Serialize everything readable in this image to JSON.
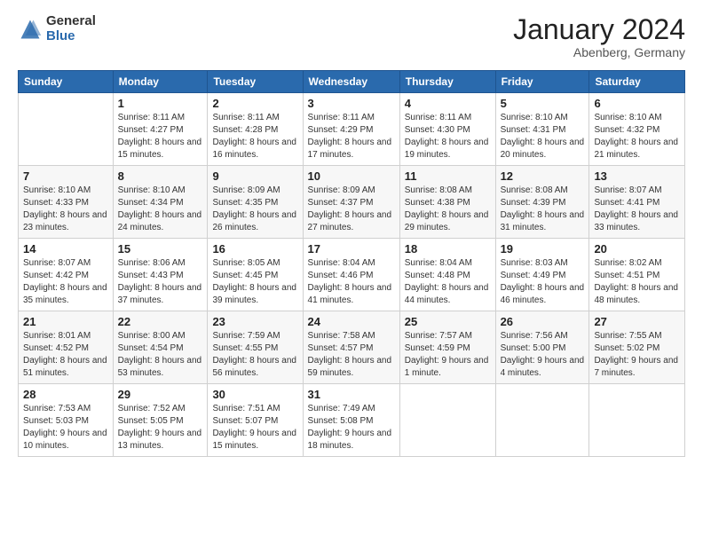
{
  "header": {
    "logo_general": "General",
    "logo_blue": "Blue",
    "month_title": "January 2024",
    "location": "Abenberg, Germany"
  },
  "days_of_week": [
    "Sunday",
    "Monday",
    "Tuesday",
    "Wednesday",
    "Thursday",
    "Friday",
    "Saturday"
  ],
  "weeks": [
    [
      {
        "day": "",
        "sunrise": "",
        "sunset": "",
        "daylight": ""
      },
      {
        "day": "1",
        "sunrise": "Sunrise: 8:11 AM",
        "sunset": "Sunset: 4:27 PM",
        "daylight": "Daylight: 8 hours and 15 minutes."
      },
      {
        "day": "2",
        "sunrise": "Sunrise: 8:11 AM",
        "sunset": "Sunset: 4:28 PM",
        "daylight": "Daylight: 8 hours and 16 minutes."
      },
      {
        "day": "3",
        "sunrise": "Sunrise: 8:11 AM",
        "sunset": "Sunset: 4:29 PM",
        "daylight": "Daylight: 8 hours and 17 minutes."
      },
      {
        "day": "4",
        "sunrise": "Sunrise: 8:11 AM",
        "sunset": "Sunset: 4:30 PM",
        "daylight": "Daylight: 8 hours and 19 minutes."
      },
      {
        "day": "5",
        "sunrise": "Sunrise: 8:10 AM",
        "sunset": "Sunset: 4:31 PM",
        "daylight": "Daylight: 8 hours and 20 minutes."
      },
      {
        "day": "6",
        "sunrise": "Sunrise: 8:10 AM",
        "sunset": "Sunset: 4:32 PM",
        "daylight": "Daylight: 8 hours and 21 minutes."
      }
    ],
    [
      {
        "day": "7",
        "sunrise": "Sunrise: 8:10 AM",
        "sunset": "Sunset: 4:33 PM",
        "daylight": "Daylight: 8 hours and 23 minutes."
      },
      {
        "day": "8",
        "sunrise": "Sunrise: 8:10 AM",
        "sunset": "Sunset: 4:34 PM",
        "daylight": "Daylight: 8 hours and 24 minutes."
      },
      {
        "day": "9",
        "sunrise": "Sunrise: 8:09 AM",
        "sunset": "Sunset: 4:35 PM",
        "daylight": "Daylight: 8 hours and 26 minutes."
      },
      {
        "day": "10",
        "sunrise": "Sunrise: 8:09 AM",
        "sunset": "Sunset: 4:37 PM",
        "daylight": "Daylight: 8 hours and 27 minutes."
      },
      {
        "day": "11",
        "sunrise": "Sunrise: 8:08 AM",
        "sunset": "Sunset: 4:38 PM",
        "daylight": "Daylight: 8 hours and 29 minutes."
      },
      {
        "day": "12",
        "sunrise": "Sunrise: 8:08 AM",
        "sunset": "Sunset: 4:39 PM",
        "daylight": "Daylight: 8 hours and 31 minutes."
      },
      {
        "day": "13",
        "sunrise": "Sunrise: 8:07 AM",
        "sunset": "Sunset: 4:41 PM",
        "daylight": "Daylight: 8 hours and 33 minutes."
      }
    ],
    [
      {
        "day": "14",
        "sunrise": "Sunrise: 8:07 AM",
        "sunset": "Sunset: 4:42 PM",
        "daylight": "Daylight: 8 hours and 35 minutes."
      },
      {
        "day": "15",
        "sunrise": "Sunrise: 8:06 AM",
        "sunset": "Sunset: 4:43 PM",
        "daylight": "Daylight: 8 hours and 37 minutes."
      },
      {
        "day": "16",
        "sunrise": "Sunrise: 8:05 AM",
        "sunset": "Sunset: 4:45 PM",
        "daylight": "Daylight: 8 hours and 39 minutes."
      },
      {
        "day": "17",
        "sunrise": "Sunrise: 8:04 AM",
        "sunset": "Sunset: 4:46 PM",
        "daylight": "Daylight: 8 hours and 41 minutes."
      },
      {
        "day": "18",
        "sunrise": "Sunrise: 8:04 AM",
        "sunset": "Sunset: 4:48 PM",
        "daylight": "Daylight: 8 hours and 44 minutes."
      },
      {
        "day": "19",
        "sunrise": "Sunrise: 8:03 AM",
        "sunset": "Sunset: 4:49 PM",
        "daylight": "Daylight: 8 hours and 46 minutes."
      },
      {
        "day": "20",
        "sunrise": "Sunrise: 8:02 AM",
        "sunset": "Sunset: 4:51 PM",
        "daylight": "Daylight: 8 hours and 48 minutes."
      }
    ],
    [
      {
        "day": "21",
        "sunrise": "Sunrise: 8:01 AM",
        "sunset": "Sunset: 4:52 PM",
        "daylight": "Daylight: 8 hours and 51 minutes."
      },
      {
        "day": "22",
        "sunrise": "Sunrise: 8:00 AM",
        "sunset": "Sunset: 4:54 PM",
        "daylight": "Daylight: 8 hours and 53 minutes."
      },
      {
        "day": "23",
        "sunrise": "Sunrise: 7:59 AM",
        "sunset": "Sunset: 4:55 PM",
        "daylight": "Daylight: 8 hours and 56 minutes."
      },
      {
        "day": "24",
        "sunrise": "Sunrise: 7:58 AM",
        "sunset": "Sunset: 4:57 PM",
        "daylight": "Daylight: 8 hours and 59 minutes."
      },
      {
        "day": "25",
        "sunrise": "Sunrise: 7:57 AM",
        "sunset": "Sunset: 4:59 PM",
        "daylight": "Daylight: 9 hours and 1 minute."
      },
      {
        "day": "26",
        "sunrise": "Sunrise: 7:56 AM",
        "sunset": "Sunset: 5:00 PM",
        "daylight": "Daylight: 9 hours and 4 minutes."
      },
      {
        "day": "27",
        "sunrise": "Sunrise: 7:55 AM",
        "sunset": "Sunset: 5:02 PM",
        "daylight": "Daylight: 9 hours and 7 minutes."
      }
    ],
    [
      {
        "day": "28",
        "sunrise": "Sunrise: 7:53 AM",
        "sunset": "Sunset: 5:03 PM",
        "daylight": "Daylight: 9 hours and 10 minutes."
      },
      {
        "day": "29",
        "sunrise": "Sunrise: 7:52 AM",
        "sunset": "Sunset: 5:05 PM",
        "daylight": "Daylight: 9 hours and 13 minutes."
      },
      {
        "day": "30",
        "sunrise": "Sunrise: 7:51 AM",
        "sunset": "Sunset: 5:07 PM",
        "daylight": "Daylight: 9 hours and 15 minutes."
      },
      {
        "day": "31",
        "sunrise": "Sunrise: 7:49 AM",
        "sunset": "Sunset: 5:08 PM",
        "daylight": "Daylight: 9 hours and 18 minutes."
      },
      {
        "day": "",
        "sunrise": "",
        "sunset": "",
        "daylight": ""
      },
      {
        "day": "",
        "sunrise": "",
        "sunset": "",
        "daylight": ""
      },
      {
        "day": "",
        "sunrise": "",
        "sunset": "",
        "daylight": ""
      }
    ]
  ]
}
